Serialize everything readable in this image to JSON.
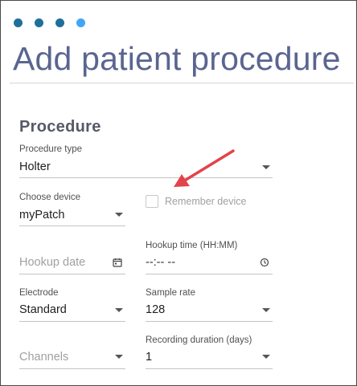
{
  "header": {
    "step_dots": [
      "#1f6f9c",
      "#1f6f9c",
      "#1f6f9c",
      "#42a5f5"
    ],
    "title": "Add patient procedure"
  },
  "procedure": {
    "section_title": "Procedure",
    "procedure_type": {
      "label": "Procedure type",
      "value": "Holter"
    },
    "choose_device": {
      "label": "Choose device",
      "value": "myPatch"
    },
    "remember_device": {
      "label": "Remember device",
      "checked": false
    },
    "hookup_date": {
      "placeholder": "Hookup date",
      "icon": "calendar-icon"
    },
    "hookup_time": {
      "label": "Hookup time (HH:MM)",
      "value": "--:-- --",
      "icon": "clock-icon"
    },
    "electrode": {
      "label": "Electrode",
      "value": "Standard"
    },
    "sample_rate": {
      "label": "Sample rate",
      "value": "128"
    },
    "channels": {
      "placeholder": "Channels"
    },
    "recording_duration": {
      "label": "Recording duration (days)",
      "value": "1"
    }
  },
  "annotation": {
    "arrow_color": "#e2434b",
    "icon": "red-arrow-icon"
  }
}
